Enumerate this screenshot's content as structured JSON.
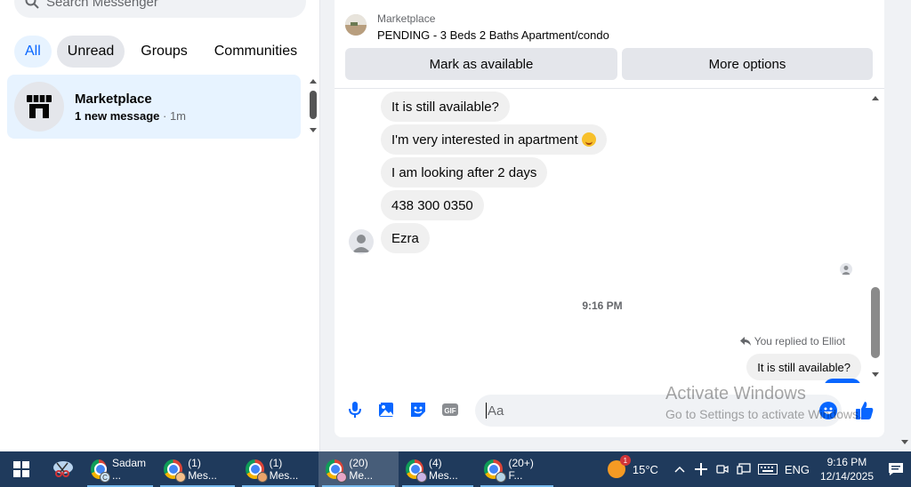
{
  "sidebar": {
    "search_placeholder": "Search Messenger",
    "filters": [
      "All",
      "Unread",
      "Groups",
      "Communities"
    ],
    "chat": {
      "name": "Marketplace",
      "preview": "1 new message",
      "separator": " · ",
      "time": "1m"
    }
  },
  "conversation": {
    "header": {
      "label": "Marketplace",
      "title": "PENDING - 3 Beds 2 Baths Apartment/condo",
      "mark_available": "Mark as available",
      "more_options": "More options"
    },
    "messages": [
      "It is still available?",
      "I'm very interested in apartment",
      "I am looking after 2 days",
      "438 300 0350",
      "Ezra"
    ],
    "time_divider": "9:16 PM",
    "reply_notice": "You replied to Elliot",
    "quoted_text": "It is still available?",
    "composer_placeholder": "Aa"
  },
  "watermark": {
    "line1": "Activate Windows",
    "line2": "Go to Settings to activate Windows."
  },
  "taskbar": {
    "apps": [
      {
        "label": "Sadam ...",
        "badge": "C"
      },
      {
        "label": "(1) Mes...",
        "badge": ""
      },
      {
        "label": "(1) Mes...",
        "badge": ""
      },
      {
        "label": "(20) Me...",
        "badge": ""
      },
      {
        "label": "(4) Mes...",
        "badge": ""
      },
      {
        "label": "(20+) F...",
        "badge": ""
      }
    ],
    "weather_badge": "1",
    "temperature": "15°C",
    "language": "ENG",
    "time": "9:16 PM",
    "date": "12/14/2025"
  },
  "colors": {
    "accent": "#0866ff",
    "selected_bg": "#e7f3ff",
    "taskbar": "#1f3a5c"
  }
}
